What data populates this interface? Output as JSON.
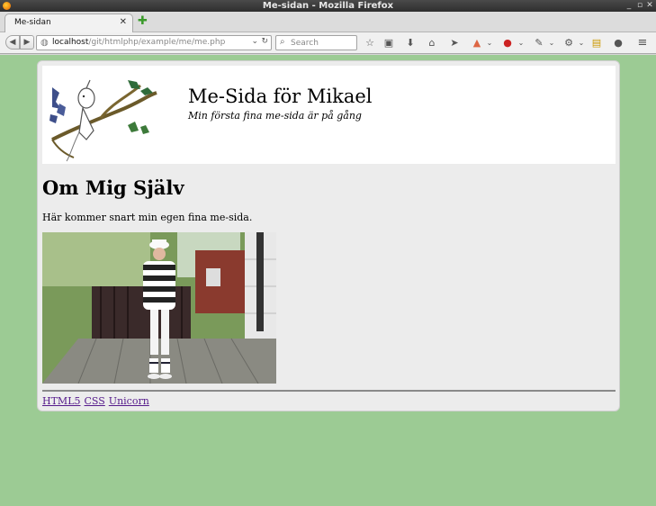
{
  "window": {
    "title": "Me-sidan - Mozilla Firefox",
    "minimize": "_",
    "maximize": "▫",
    "close": "✕"
  },
  "tab": {
    "label": "Me-sidan",
    "close": "✕",
    "new": "✚"
  },
  "nav": {
    "back": "◀",
    "forward": "▶",
    "url_host": "localhost",
    "url_path": "/git/htmlphp/example/me/me.php",
    "search_placeholder": "Search"
  },
  "toolbar_icons": [
    "star-icon",
    "clipboard-icon",
    "download-icon",
    "home-icon",
    "send-icon",
    "sync-icon",
    "adblock-icon",
    "eyedropper-icon",
    "developer-icon",
    "reader-icon",
    "chat-icon",
    "menu-icon"
  ],
  "page": {
    "site_title": "Me-Sida för Mikael",
    "site_subtitle": "Min första fina me-sida är på gång",
    "heading": "Om Mig Själv",
    "intro": "Här kommer snart min egen fina me-sida.",
    "links": [
      "HTML5",
      "CSS",
      "Unicorn"
    ]
  },
  "colors": {
    "page_bg": "#9ccb94",
    "box_bg": "#ececec",
    "link": "#551a8b"
  }
}
